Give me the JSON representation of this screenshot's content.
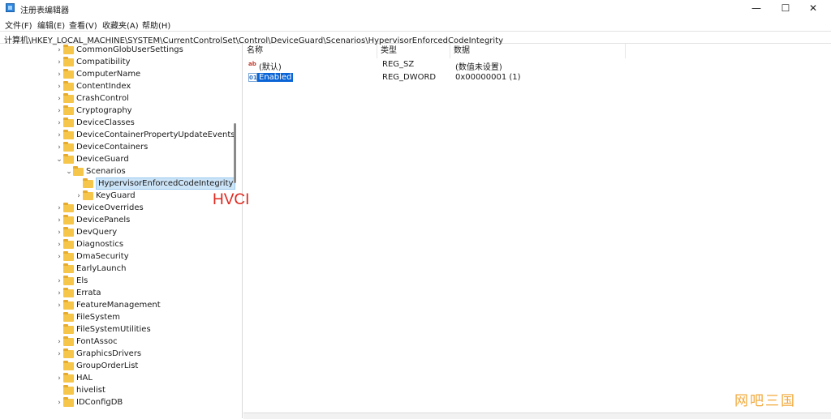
{
  "window": {
    "title": "注册表编辑器",
    "controls": {
      "minimize": "—",
      "maximize": "☐",
      "close": "✕"
    }
  },
  "menu": [
    "文件(F)",
    "编辑(E)",
    "查看(V)",
    "收藏夹(A)",
    "帮助(H)"
  ],
  "address": "计算机\\HKEY_LOCAL_MACHINE\\SYSTEM\\CurrentControlSet\\Control\\DeviceGuard\\Scenarios\\HypervisorEnforcedCodeIntegrity",
  "tree": [
    {
      "label": "CommonGlobUserSettings",
      "level": 0,
      "state": "collapsed"
    },
    {
      "label": "Compatibility",
      "level": 0,
      "state": "collapsed"
    },
    {
      "label": "ComputerName",
      "level": 0,
      "state": "collapsed"
    },
    {
      "label": "ContentIndex",
      "level": 0,
      "state": "collapsed"
    },
    {
      "label": "CrashControl",
      "level": 0,
      "state": "collapsed"
    },
    {
      "label": "Cryptography",
      "level": 0,
      "state": "collapsed"
    },
    {
      "label": "DeviceClasses",
      "level": 0,
      "state": "collapsed"
    },
    {
      "label": "DeviceContainerPropertyUpdateEvents",
      "level": 0,
      "state": "collapsed"
    },
    {
      "label": "DeviceContainers",
      "level": 0,
      "state": "collapsed"
    },
    {
      "label": "DeviceGuard",
      "level": 0,
      "state": "expanded"
    },
    {
      "label": "Scenarios",
      "level": 1,
      "state": "expanded"
    },
    {
      "label": "HypervisorEnforcedCodeIntegrity",
      "level": 2,
      "state": "leaf",
      "selected": true
    },
    {
      "label": "KeyGuard",
      "level": 2,
      "state": "collapsed"
    },
    {
      "label": "DeviceOverrides",
      "level": 0,
      "state": "collapsed"
    },
    {
      "label": "DevicePanels",
      "level": 0,
      "state": "collapsed"
    },
    {
      "label": "DevQuery",
      "level": 0,
      "state": "collapsed"
    },
    {
      "label": "Diagnostics",
      "level": 0,
      "state": "collapsed"
    },
    {
      "label": "DmaSecurity",
      "level": 0,
      "state": "collapsed"
    },
    {
      "label": "EarlyLaunch",
      "level": 0,
      "state": "leaf"
    },
    {
      "label": "Els",
      "level": 0,
      "state": "collapsed"
    },
    {
      "label": "Errata",
      "level": 0,
      "state": "collapsed"
    },
    {
      "label": "FeatureManagement",
      "level": 0,
      "state": "collapsed"
    },
    {
      "label": "FileSystem",
      "level": 0,
      "state": "leaf"
    },
    {
      "label": "FileSystemUtilities",
      "level": 0,
      "state": "leaf"
    },
    {
      "label": "FontAssoc",
      "level": 0,
      "state": "collapsed"
    },
    {
      "label": "GraphicsDrivers",
      "level": 0,
      "state": "collapsed"
    },
    {
      "label": "GroupOrderList",
      "level": 0,
      "state": "leaf"
    },
    {
      "label": "HAL",
      "level": 0,
      "state": "collapsed"
    },
    {
      "label": "hivelist",
      "level": 0,
      "state": "leaf"
    },
    {
      "label": "IDConfigDB",
      "level": 0,
      "state": "collapsed"
    }
  ],
  "columns": [
    "名称",
    "类型",
    "数据"
  ],
  "values": [
    {
      "icon": "string-value-icon",
      "name": "(默认)",
      "type": "REG_SZ",
      "data": "(数值未设置)",
      "selected": false
    },
    {
      "icon": "dword-value-icon",
      "name": "Enabled",
      "type": "REG_DWORD",
      "data": "0x00000001 (1)",
      "selected": true
    }
  ],
  "annotation": "HVCI",
  "watermark": "网吧三国",
  "colors": {
    "selection": "#0a64d6",
    "annotation": "#e0281f",
    "folder": "#f6c64a",
    "watermark": "#f2a93b"
  }
}
